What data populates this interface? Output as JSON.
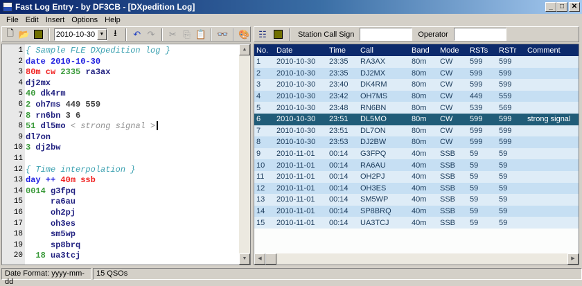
{
  "window": {
    "title": "Fast Log Entry - by DF3CB - [DXpedition Log]",
    "minimize": "_",
    "maximize": "□",
    "close": "✕"
  },
  "menu": [
    "File",
    "Edit",
    "Insert",
    "Options",
    "Help"
  ],
  "toolbar": {
    "date_value": "2010-10-30"
  },
  "right_toolbar": {
    "station_label": "Station Call Sign",
    "station_value": "",
    "operator_label": "Operator",
    "operator_value": ""
  },
  "editor": {
    "lines": [
      [
        {
          "t": "{ Sample FLE DXpedition log }",
          "c": "cmt"
        }
      ],
      [
        {
          "t": "date ",
          "c": "kw"
        },
        {
          "t": "2010-10-30",
          "c": "kw"
        }
      ],
      [
        {
          "t": "80m cw ",
          "c": "band"
        },
        {
          "t": "2335 ",
          "c": "num"
        },
        {
          "t": "ra3ax",
          "c": "call"
        }
      ],
      [
        {
          "t": "dj2mx",
          "c": "call"
        }
      ],
      [
        {
          "t": "40 ",
          "c": "num"
        },
        {
          "t": "dk4rm",
          "c": "call"
        }
      ],
      [
        {
          "t": "2 ",
          "c": "num"
        },
        {
          "t": "oh7ms ",
          "c": "call"
        },
        {
          "t": "449 559",
          "c": "plain"
        }
      ],
      [
        {
          "t": "8 ",
          "c": "num"
        },
        {
          "t": "rn6bn ",
          "c": "call"
        },
        {
          "t": "3 6",
          "c": "plain"
        }
      ],
      [
        {
          "t": "51 ",
          "c": "num"
        },
        {
          "t": "dl5mo ",
          "c": "call"
        },
        {
          "t": "< strong signal >",
          "c": "note"
        }
      ],
      [
        {
          "t": "dl7on",
          "c": "call"
        }
      ],
      [
        {
          "t": "3 ",
          "c": "num"
        },
        {
          "t": "dj2bw",
          "c": "call"
        }
      ],
      [],
      [
        {
          "t": "{ Time interpolation }",
          "c": "cmt"
        }
      ],
      [
        {
          "t": "day ++ ",
          "c": "kw"
        },
        {
          "t": "40m ssb",
          "c": "band"
        }
      ],
      [
        {
          "t": "0014 ",
          "c": "num"
        },
        {
          "t": "g3fpq",
          "c": "call"
        }
      ],
      [
        {
          "t": "     ra6au",
          "c": "call"
        }
      ],
      [
        {
          "t": "     oh2pj",
          "c": "call"
        }
      ],
      [
        {
          "t": "     oh3es",
          "c": "call"
        }
      ],
      [
        {
          "t": "     sm5wp",
          "c": "call"
        }
      ],
      [
        {
          "t": "     sp8brq",
          "c": "call"
        }
      ],
      [
        {
          "t": "  18 ",
          "c": "num"
        },
        {
          "t": "ua3tcj",
          "c": "call"
        }
      ]
    ]
  },
  "log": {
    "columns": [
      "No.",
      "Date",
      "Time",
      "Call",
      "Band",
      "Mode",
      "RSTs",
      "RSTr",
      "Comment"
    ],
    "selected_row": 6,
    "rows": [
      [
        "1",
        "2010-10-30",
        "23:35",
        "RA3AX",
        "80m",
        "CW",
        "599",
        "599",
        ""
      ],
      [
        "2",
        "2010-10-30",
        "23:35",
        "DJ2MX",
        "80m",
        "CW",
        "599",
        "599",
        ""
      ],
      [
        "3",
        "2010-10-30",
        "23:40",
        "DK4RM",
        "80m",
        "CW",
        "599",
        "599",
        ""
      ],
      [
        "4",
        "2010-10-30",
        "23:42",
        "OH7MS",
        "80m",
        "CW",
        "449",
        "559",
        ""
      ],
      [
        "5",
        "2010-10-30",
        "23:48",
        "RN6BN",
        "80m",
        "CW",
        "539",
        "569",
        ""
      ],
      [
        "6",
        "2010-10-30",
        "23:51",
        "DL5MO",
        "80m",
        "CW",
        "599",
        "599",
        "strong signal"
      ],
      [
        "7",
        "2010-10-30",
        "23:51",
        "DL7ON",
        "80m",
        "CW",
        "599",
        "599",
        ""
      ],
      [
        "8",
        "2010-10-30",
        "23:53",
        "DJ2BW",
        "80m",
        "CW",
        "599",
        "599",
        ""
      ],
      [
        "9",
        "2010-11-01",
        "00:14",
        "G3FPQ",
        "40m",
        "SSB",
        "59",
        "59",
        ""
      ],
      [
        "10",
        "2010-11-01",
        "00:14",
        "RA6AU",
        "40m",
        "SSB",
        "59",
        "59",
        ""
      ],
      [
        "11",
        "2010-11-01",
        "00:14",
        "OH2PJ",
        "40m",
        "SSB",
        "59",
        "59",
        ""
      ],
      [
        "12",
        "2010-11-01",
        "00:14",
        "OH3ES",
        "40m",
        "SSB",
        "59",
        "59",
        ""
      ],
      [
        "13",
        "2010-11-01",
        "00:14",
        "SM5WP",
        "40m",
        "SSB",
        "59",
        "59",
        ""
      ],
      [
        "14",
        "2010-11-01",
        "00:14",
        "SP8BRQ",
        "40m",
        "SSB",
        "59",
        "59",
        ""
      ],
      [
        "15",
        "2010-11-01",
        "00:14",
        "UA3TCJ",
        "40m",
        "SSB",
        "59",
        "59",
        ""
      ]
    ]
  },
  "status": {
    "date_format": "Date Format: yyyy-mm-dd",
    "qso_count": "15 QSOs"
  }
}
